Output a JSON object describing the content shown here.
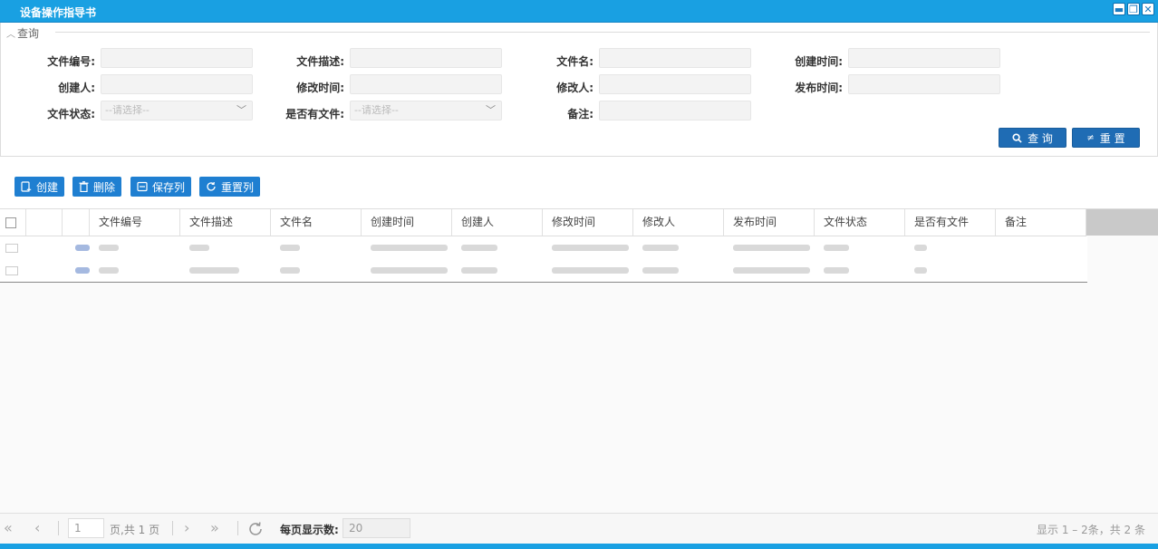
{
  "window": {
    "title": "设备操作指导书"
  },
  "query": {
    "legend": "查询",
    "fields": [
      {
        "label": "文件编号:",
        "value": ""
      },
      {
        "label": "文件描述:",
        "value": ""
      },
      {
        "label": "文件名:",
        "value": ""
      },
      {
        "label": "创建时间:",
        "value": ""
      },
      {
        "label": "创建人:",
        "value": ""
      },
      {
        "label": "修改时间:",
        "value": ""
      },
      {
        "label": "修改人:",
        "value": ""
      },
      {
        "label": "发布时间:",
        "value": ""
      },
      {
        "label": "文件状态:",
        "value": "--请选择--"
      },
      {
        "label": "是否有文件:",
        "value": "--请选择--"
      },
      {
        "label": "备注:",
        "value": ""
      }
    ],
    "search_label": "查 询",
    "reset_label": "重 置"
  },
  "toolbar": {
    "create": "创建",
    "delete": "删除",
    "save_cols": "保存列",
    "reset_cols": "重置列"
  },
  "grid": {
    "columns": [
      "文件编号",
      "文件描述",
      "文件名",
      "创建时间",
      "创建人",
      "修改时间",
      "修改人",
      "发布时间",
      "文件状态",
      "是否有文件",
      "备注"
    ]
  },
  "pager": {
    "page": "1",
    "page_total_text": "页,共 1 页",
    "page_size_label": "每页显示数:",
    "page_size": "20",
    "summary": "显示 1 – 2条，共 2 条"
  },
  "colors": {
    "titlebar": "#19a0e2",
    "primary_button": "#1f7fd1",
    "query_button": "#1f6cb4"
  }
}
